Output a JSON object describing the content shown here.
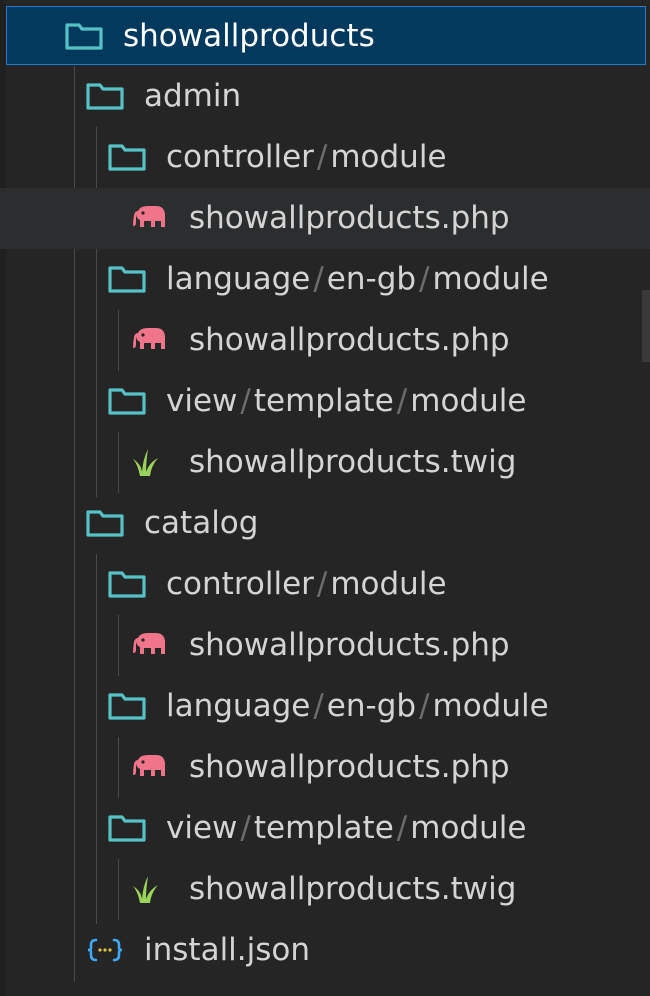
{
  "explorer": {
    "root": {
      "label": "showallproducts",
      "icon": "folder-icon"
    },
    "admin": {
      "label": "admin",
      "controller": {
        "parts": [
          "controller",
          "module"
        ],
        "file": "showallproducts.php"
      },
      "language": {
        "parts": [
          "language",
          "en-gb",
          "module"
        ],
        "file": "showallproducts.php"
      },
      "view": {
        "parts": [
          "view",
          "template",
          "module"
        ],
        "file": "showallproducts.twig"
      }
    },
    "catalog": {
      "label": "catalog",
      "controller": {
        "parts": [
          "controller",
          "module"
        ],
        "file": "showallproducts.php"
      },
      "language": {
        "parts": [
          "language",
          "en-gb",
          "module"
        ],
        "file": "showallproducts.php"
      },
      "view": {
        "parts": [
          "view",
          "template",
          "module"
        ],
        "file": "showallproducts.twig"
      }
    },
    "install": {
      "label": "install.json",
      "icon": "json-icon"
    },
    "separator": "/",
    "colors": {
      "folder": "#56c2c6",
      "php": "#f0758a",
      "twig": "#9bd45a",
      "json": "#3fa9f5",
      "selection": "#04395e"
    }
  }
}
